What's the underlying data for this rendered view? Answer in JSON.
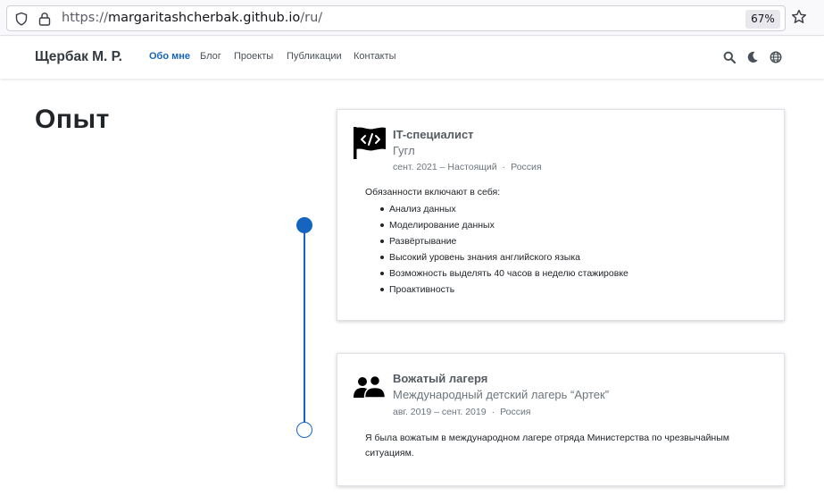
{
  "browser": {
    "url_scheme": "https://",
    "url_host": "margaritashcherbak.github.io",
    "url_path": "/ru/",
    "zoom": "67%"
  },
  "navbar": {
    "brand": "Щербак М. Р.",
    "links": [
      {
        "label": "Обо мне",
        "active": true
      },
      {
        "label": "Блог",
        "active": false
      },
      {
        "label": "Проекты",
        "active": false
      },
      {
        "label": "Публикации",
        "active": false
      },
      {
        "label": "Контакты",
        "active": false
      }
    ],
    "icons": [
      "search-icon",
      "moon-icon",
      "globe-icon"
    ]
  },
  "page": {
    "title": "Опыт"
  },
  "experience": [
    {
      "icon": "code-flag-icon",
      "title": "IT-специалист",
      "org": "Гугл",
      "dates": "сент. 2021 – Настоящий",
      "location": "Россия",
      "intro": "Обязанности включают в себя:",
      "items": [
        "Анализ данных",
        "Моделирование данных",
        "Развёртывание",
        "Высокий уровень знания английского языка",
        "Возможность выделять 40 часов в неделю стажировке",
        "Проактивность"
      ]
    },
    {
      "icon": "users-icon",
      "title": "Вожатый лагеря",
      "org": "Международный детский лагерь “Артек”",
      "dates": "авг. 2019 – сент. 2019",
      "location": "Россия",
      "description": "Я была вожатым в международном лагере отряда Министерства по чрезвычайным ситуациям."
    }
  ],
  "colors": {
    "accent": "#1565c0",
    "text": "#212529",
    "muted": "#6c757d"
  }
}
